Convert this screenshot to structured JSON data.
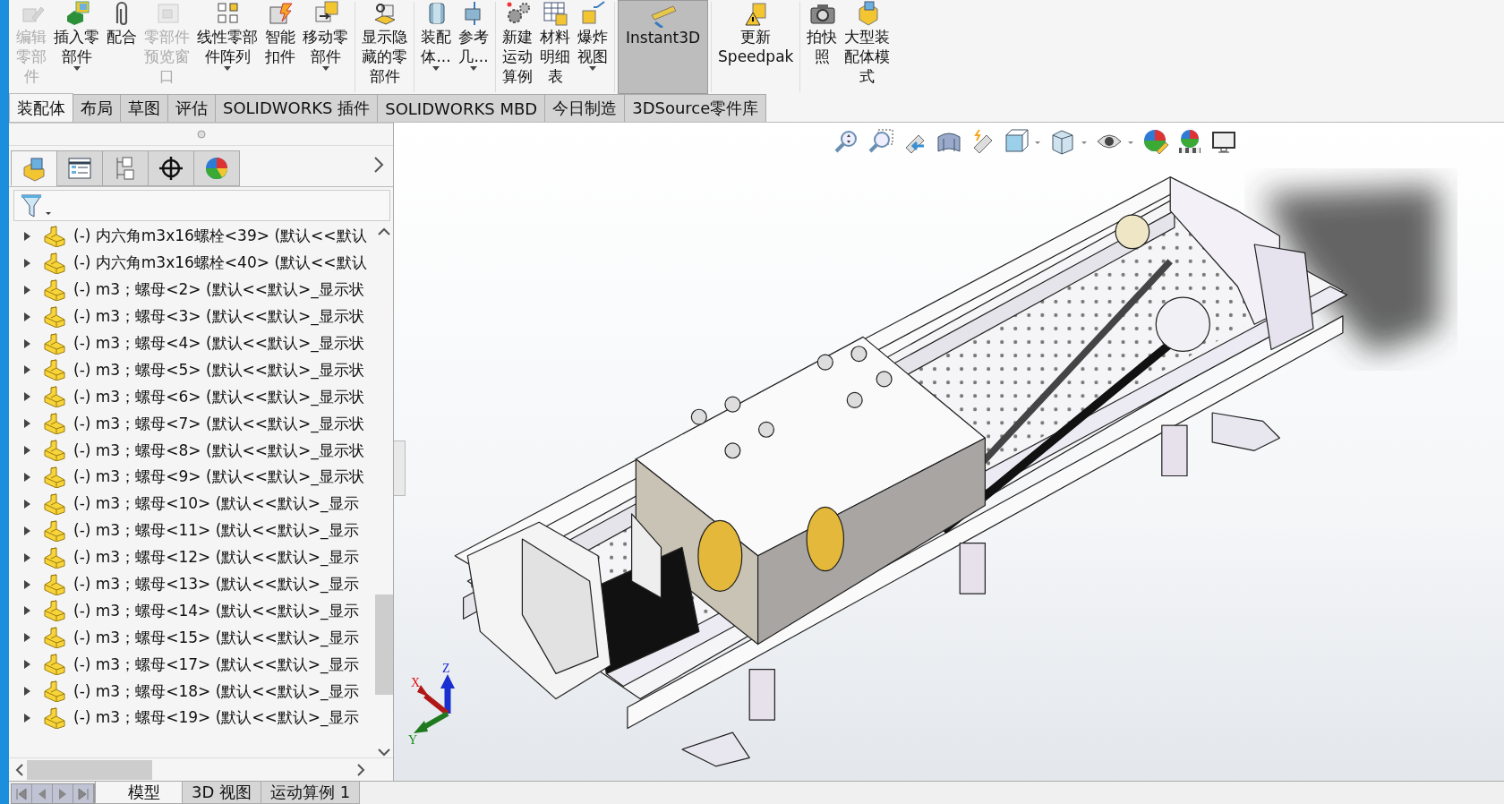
{
  "ribbon": {
    "buttons": [
      {
        "lines": [
          "编辑",
          "零部",
          "件"
        ],
        "disabled": true,
        "dropdown": false,
        "selected": false
      },
      {
        "lines": [
          "插入零",
          "部件"
        ],
        "disabled": false,
        "dropdown": true,
        "selected": false
      },
      {
        "lines": [
          "配合"
        ],
        "disabled": false,
        "dropdown": false,
        "selected": false
      },
      {
        "lines": [
          "零部件",
          "预览窗",
          "口"
        ],
        "disabled": true,
        "dropdown": false,
        "selected": false
      },
      {
        "lines": [
          "线性零部",
          "件阵列"
        ],
        "disabled": false,
        "dropdown": true,
        "selected": false
      },
      {
        "lines": [
          "智能",
          "扣件"
        ],
        "disabled": false,
        "dropdown": false,
        "selected": false
      },
      {
        "lines": [
          "移动零",
          "部件"
        ],
        "disabled": false,
        "dropdown": true,
        "selected": false
      },
      {
        "lines": [
          "显示隐",
          "藏的零",
          "部件"
        ],
        "disabled": false,
        "dropdown": false,
        "selected": false
      },
      {
        "lines": [
          "装配",
          "体..."
        ],
        "disabled": false,
        "dropdown": true,
        "selected": false
      },
      {
        "lines": [
          "参考",
          "几..."
        ],
        "disabled": false,
        "dropdown": true,
        "selected": false
      },
      {
        "lines": [
          "新建",
          "运动",
          "算例"
        ],
        "disabled": false,
        "dropdown": false,
        "selected": false
      },
      {
        "lines": [
          "材料",
          "明细",
          "表"
        ],
        "disabled": false,
        "dropdown": false,
        "selected": false
      },
      {
        "lines": [
          "爆炸",
          "视图"
        ],
        "disabled": false,
        "dropdown": true,
        "selected": false
      },
      {
        "lines": [
          "Instant3D"
        ],
        "disabled": false,
        "dropdown": false,
        "selected": true
      },
      {
        "lines": [
          "更新",
          "Speedpak"
        ],
        "disabled": false,
        "dropdown": false,
        "selected": false
      },
      {
        "lines": [
          "拍快",
          "照"
        ],
        "disabled": false,
        "dropdown": false,
        "selected": false
      },
      {
        "lines": [
          "大型装",
          "配体模",
          "式"
        ],
        "disabled": false,
        "dropdown": false,
        "selected": false
      }
    ]
  },
  "command_tabs": [
    {
      "label": "装配体",
      "selected": true
    },
    {
      "label": "布局",
      "selected": false
    },
    {
      "label": "草图",
      "selected": false
    },
    {
      "label": "评估",
      "selected": false
    },
    {
      "label": "SOLIDWORKS 插件",
      "selected": false
    },
    {
      "label": "SOLIDWORKS MBD",
      "selected": false
    },
    {
      "label": "今日制造",
      "selected": false
    },
    {
      "label": "3DSource零件库",
      "selected": false
    }
  ],
  "feature_tree": {
    "panel_tabs": [
      {
        "selected": true
      },
      {
        "selected": false
      },
      {
        "selected": false
      },
      {
        "selected": false
      },
      {
        "selected": false
      }
    ],
    "items": [
      {
        "label": "(-) 内六角m3x16螺栓<39> (默认<<默认",
        "expanded": false
      },
      {
        "label": "(-) 内六角m3x16螺栓<40> (默认<<默认",
        "expanded": false
      },
      {
        "label": "(-) m3；螺母<2> (默认<<默认>_显示状",
        "expanded": false
      },
      {
        "label": "(-) m3；螺母<3> (默认<<默认>_显示状",
        "expanded": false
      },
      {
        "label": "(-) m3；螺母<4> (默认<<默认>_显示状",
        "expanded": false
      },
      {
        "label": "(-) m3；螺母<5> (默认<<默认>_显示状",
        "expanded": false
      },
      {
        "label": "(-) m3；螺母<6> (默认<<默认>_显示状",
        "expanded": false
      },
      {
        "label": "(-) m3；螺母<7> (默认<<默认>_显示状",
        "expanded": false
      },
      {
        "label": "(-) m3；螺母<8> (默认<<默认>_显示状",
        "expanded": false
      },
      {
        "label": "(-) m3；螺母<9> (默认<<默认>_显示状",
        "expanded": false
      },
      {
        "label": "(-) m3；螺母<10> (默认<<默认>_显示",
        "expanded": false
      },
      {
        "label": "(-) m3；螺母<11> (默认<<默认>_显示",
        "expanded": false
      },
      {
        "label": "(-) m3；螺母<12> (默认<<默认>_显示",
        "expanded": false
      },
      {
        "label": "(-) m3；螺母<13> (默认<<默认>_显示",
        "expanded": false
      },
      {
        "label": "(-) m3；螺母<14> (默认<<默认>_显示",
        "expanded": false
      },
      {
        "label": "(-) m3；螺母<15> (默认<<默认>_显示",
        "expanded": false
      },
      {
        "label": "(-) m3；螺母<17> (默认<<默认>_显示",
        "expanded": false
      },
      {
        "label": "(-) m3；螺母<18> (默认<<默认>_显示",
        "expanded": false
      },
      {
        "label": "(-) m3；螺母<19> (默认<<默认>_显示",
        "expanded": false
      }
    ]
  },
  "viewport": {
    "triad": {
      "x_label": "X",
      "y_label": "Y",
      "z_label": "Z"
    }
  },
  "bottom_tabs": [
    {
      "label": "模型",
      "selected": true
    },
    {
      "label": "3D 视图",
      "selected": false
    },
    {
      "label": "运动算例 1",
      "selected": false
    }
  ]
}
